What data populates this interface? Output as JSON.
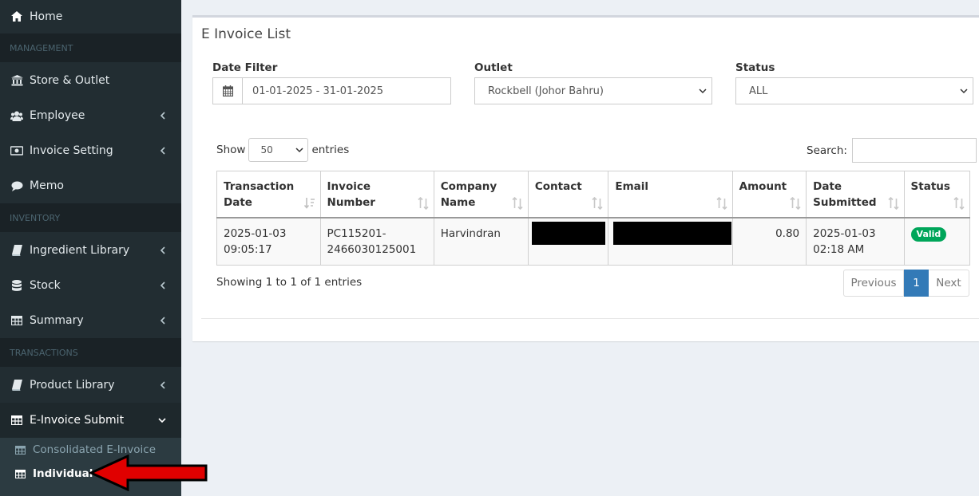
{
  "sidebar": {
    "home": "Home",
    "management_header": "MANAGEMENT",
    "store_outlet": "Store & Outlet",
    "employee": "Employee",
    "invoice_setting": "Invoice Setting",
    "memo": "Memo",
    "inventory_header": "INVENTORY",
    "ingredient_library": "Ingredient Library",
    "stock": "Stock",
    "summary": "Summary",
    "transactions_header": "TRANSACTIONS",
    "product_library": "Product Library",
    "einvoice_submit": "E-Invoice Submit",
    "consolidated": "Consolidated E-Invoice",
    "individual": "Individual"
  },
  "main": {
    "title": "E Invoice List",
    "date_filter_label": "Date Filter",
    "date_range": "01-01-2025 - 31-01-2025",
    "outlet_label": "Outlet",
    "outlet_value": "Rockbell (Johor Bahru)",
    "status_label": "Status",
    "status_value": "ALL",
    "show_label": "Show",
    "entries_value": "50",
    "entries_label": "entries",
    "search_label": "Search:"
  },
  "table": {
    "headers": [
      "Transaction Date",
      "Invoice Number",
      "Company Name",
      "Contact",
      "Email",
      "Amount",
      "Date Submitted",
      "Status"
    ],
    "rows": [
      {
        "transaction_date": "2025-01-03 09:05:17",
        "invoice_number": "PC115201-2466030125001",
        "company_name": "Harvindran",
        "contact": "",
        "email": "",
        "amount": "0.80",
        "date_submitted": "2025-01-03 02:18 AM",
        "status": "Valid"
      }
    ]
  },
  "footer": {
    "info": "Showing 1 to 1 of 1 entries",
    "previous": "Previous",
    "page": "1",
    "next": "Next"
  },
  "colors": {
    "sidebar_bg": "#222d32",
    "accent_blue": "#337ab7",
    "valid_green": "#00a65a",
    "arrow_red": "#e00000"
  }
}
